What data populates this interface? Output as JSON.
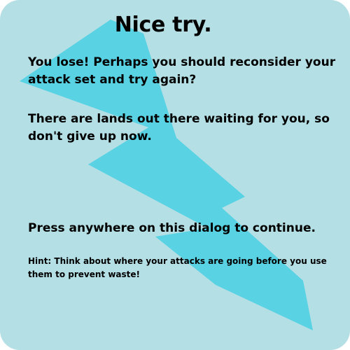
{
  "dialog": {
    "title": "Nice try.",
    "message_1": "You lose! Perhaps you should reconsider your attack set and try again?",
    "message_2": "There are lands out there waiting for you, so don't give up now.",
    "continue_prompt": "Press anywhere on this dialog to continue.",
    "hint": "Hint: Think about where your attacks are going before you use them to prevent waste!"
  },
  "colors": {
    "background": "#b3dfe5",
    "lightning": "#59d2e3",
    "text": "#000000"
  },
  "icons": {
    "decoration": "lightning-bolt-icon"
  }
}
